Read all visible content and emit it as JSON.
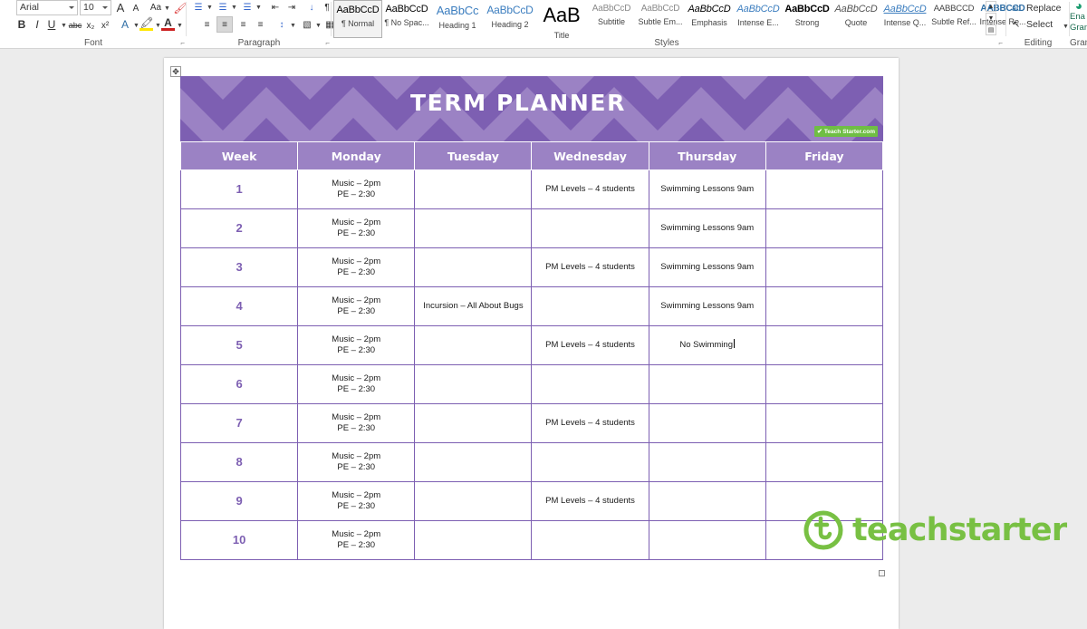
{
  "ribbon": {
    "font_group": {
      "label": "Font",
      "font_name": "Arial",
      "font_size": "10",
      "grow_font": "A",
      "shrink_font": "A",
      "change_case": "Aa",
      "clear_formatting": "clear-formatting-icon",
      "bold": "B",
      "italic": "I",
      "underline": "U",
      "strikethrough": "abc",
      "subscript": "x₂",
      "superscript": "x²",
      "text_effects": "A",
      "highlight": "highlight-icon",
      "font_color": "A"
    },
    "paragraph_group": {
      "label": "Paragraph",
      "bullets": "bullets-icon",
      "numbering": "numbering-icon",
      "multilevel": "multilevel-list-icon",
      "decrease_indent": "decrease-indent-icon",
      "increase_indent": "increase-indent-icon",
      "sort": "sort-icon",
      "show_marks": "¶",
      "align_left": "align-left-icon",
      "align_center": "align-center-icon",
      "align_right": "align-right-icon",
      "justify": "justify-icon",
      "line_spacing": "line-spacing-icon",
      "shading": "shading-icon",
      "borders": "borders-icon"
    },
    "styles_group": {
      "label": "Styles",
      "items": [
        {
          "sample": "AaBbCcD",
          "name": "¶ Normal",
          "selected": true
        },
        {
          "sample": "AaBbCcD",
          "name": "¶ No Spac...",
          "selected": false
        },
        {
          "sample": "AaBbCc",
          "name": "Heading 1",
          "selected": false
        },
        {
          "sample": "AaBbCcD",
          "name": "Heading 2",
          "selected": false
        },
        {
          "sample": "AaB",
          "name": "Title",
          "selected": false
        },
        {
          "sample": "AaBbCcD",
          "name": "Subtitle",
          "selected": false
        },
        {
          "sample": "AaBbCcD",
          "name": "Subtle Em...",
          "selected": false
        },
        {
          "sample": "AaBbCcD",
          "name": "Emphasis",
          "selected": false
        },
        {
          "sample": "AaBbCcD",
          "name": "Intense E...",
          "selected": false
        },
        {
          "sample": "AaBbCcD",
          "name": "Strong",
          "selected": false
        },
        {
          "sample": "AaBbCcD",
          "name": "Quote",
          "selected": false
        },
        {
          "sample": "AaBbCcD",
          "name": "Intense Q...",
          "selected": false
        },
        {
          "sample": "AABBCCD",
          "name": "Subtle Ref...",
          "selected": false
        },
        {
          "sample": "AABBCCD",
          "name": "Intense Re...",
          "selected": false
        }
      ]
    },
    "editing_group": {
      "label": "Editing",
      "replace": "Replace",
      "select": "Select"
    },
    "grammar_group": {
      "label": "Gram",
      "button_line1": "Ena",
      "button_line2": "Gram"
    }
  },
  "document": {
    "banner": {
      "title": "TERM PLANNER",
      "badge_prefix": "Teach",
      "badge_suffix": "Starter.com",
      "color_dark": "#7d5fb2",
      "color_light": "#9b82c4"
    },
    "table": {
      "headers": [
        "Week",
        "Monday",
        "Tuesday",
        "Wednesday",
        "Thursday",
        "Friday"
      ],
      "rows": [
        {
          "week": "1",
          "monday": "Music – 2pm\nPE – 2:30",
          "tuesday": "",
          "wednesday": "PM Levels – 4 students",
          "thursday": "Swimming Lessons 9am",
          "friday": ""
        },
        {
          "week": "2",
          "monday": "Music – 2pm\nPE – 2:30",
          "tuesday": "",
          "wednesday": "",
          "thursday": "Swimming Lessons 9am",
          "friday": ""
        },
        {
          "week": "3",
          "monday": "Music – 2pm\nPE – 2:30",
          "tuesday": "",
          "wednesday": "PM Levels – 4 students",
          "thursday": "Swimming Lessons 9am",
          "friday": ""
        },
        {
          "week": "4",
          "monday": "Music – 2pm\nPE – 2:30",
          "tuesday": "Incursion – All About Bugs",
          "wednesday": "",
          "thursday": "Swimming Lessons 9am",
          "friday": ""
        },
        {
          "week": "5",
          "monday": "Music – 2pm\nPE – 2:30",
          "tuesday": "",
          "wednesday": "PM Levels – 4 students",
          "thursday": "No Swimming",
          "friday": "",
          "caret_in": "thursday"
        },
        {
          "week": "6",
          "monday": "Music – 2pm\nPE – 2:30",
          "tuesday": "",
          "wednesday": "",
          "thursday": "",
          "friday": ""
        },
        {
          "week": "7",
          "monday": "Music – 2pm\nPE – 2:30",
          "tuesday": "",
          "wednesday": "PM Levels – 4 students",
          "thursday": "",
          "friday": ""
        },
        {
          "week": "8",
          "monday": "Music – 2pm\nPE – 2:30",
          "tuesday": "",
          "wednesday": "",
          "thursday": "",
          "friday": ""
        },
        {
          "week": "9",
          "monday": "Music – 2pm\nPE – 2:30",
          "tuesday": "",
          "wednesday": "PM Levels – 4 students",
          "thursday": "",
          "friday": ""
        },
        {
          "week": "10",
          "monday": "Music – 2pm\nPE – 2:30",
          "tuesday": "",
          "wednesday": "",
          "thursday": "",
          "friday": ""
        }
      ]
    },
    "watermark": {
      "text": "teachstarter",
      "color": "#78c043"
    }
  }
}
